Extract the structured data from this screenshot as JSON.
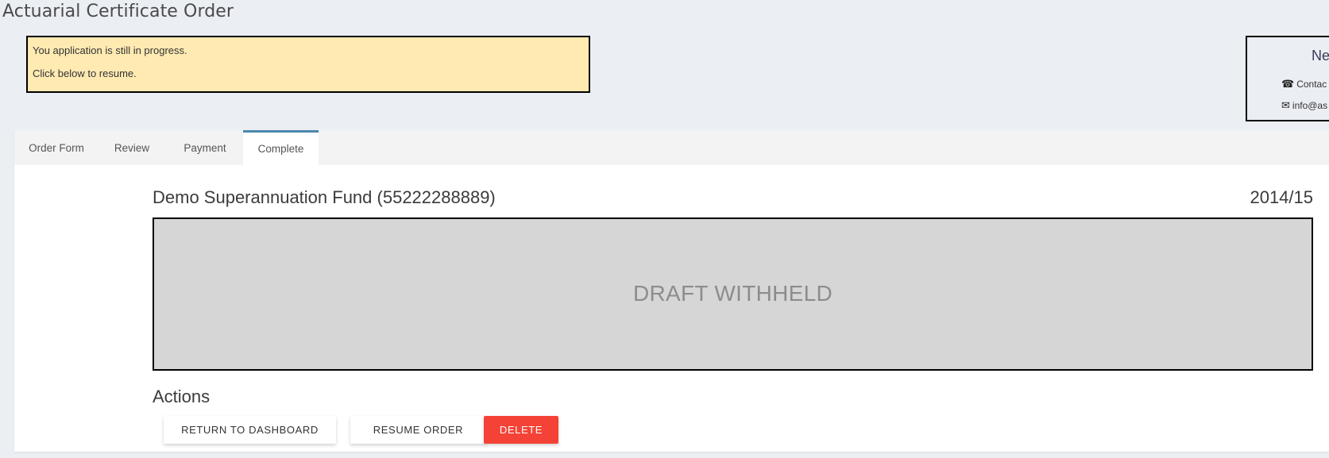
{
  "page": {
    "title": "Actuarial Certificate Order"
  },
  "alert": {
    "line1": "You application is still in progress.",
    "line2": "Click below to resume."
  },
  "contact_card": {
    "title": "Ne",
    "phone_icon": "phone-icon",
    "phone_text": "Contac",
    "email_icon": "envelope-icon",
    "email_text": "info@as"
  },
  "tabs": [
    {
      "label": "Order Form",
      "active": false
    },
    {
      "label": "Review",
      "active": false
    },
    {
      "label": "Payment",
      "active": false
    },
    {
      "label": "Complete",
      "active": true
    }
  ],
  "colors": {
    "active_tab_accent": "#4a88ae",
    "alert_bg": "#ffeab2",
    "delete_button": "#f44336",
    "draft_bg": "#d6d6d6"
  },
  "main": {
    "fund_name": "Demo Superannuation Fund (55222288889)",
    "year": "2014/15",
    "draft_label": "DRAFT WITHHELD",
    "actions_title": "Actions",
    "buttons": {
      "return": "RETURN TO DASHBOARD",
      "resume": "RESUME ORDER",
      "delete": "DELETE"
    }
  }
}
